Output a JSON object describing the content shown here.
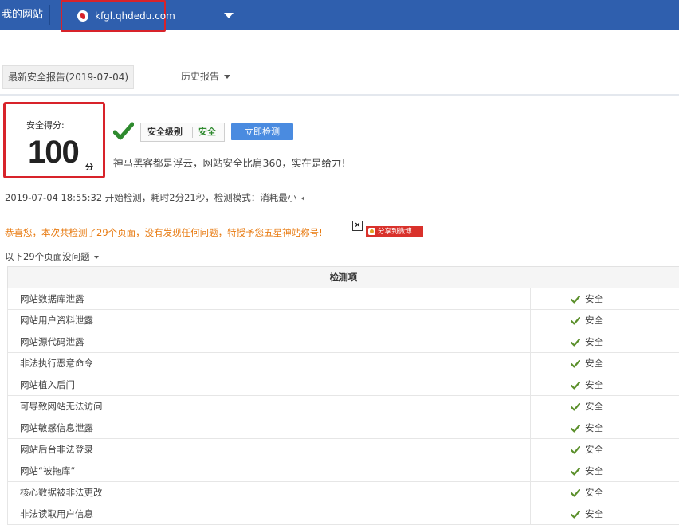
{
  "header": {
    "my_site": "我的网站",
    "domain": "kfgl.qhdedu.com"
  },
  "tabs": {
    "latest": "最新安全报告(2019-07-04)",
    "history": "历史报告"
  },
  "score": {
    "label": "安全得分:",
    "value": "100",
    "unit": "分",
    "level_label": "安全级别",
    "level_value": "安全",
    "detect_button": "立即检测",
    "motto": "神马黑客都是浮云，网站安全比肩360，实在是给力!"
  },
  "scan": {
    "info": "2019-07-04 18:55:32 开始检测，耗时2分21秒，检测模式：消耗最小",
    "congrats": "恭喜您，本次共检测了29个页面，没有发现任何问题，特授予您五星神站称号!",
    "share_button": "分享到微博",
    "close": "×",
    "pages_ok": "以下29个页面没问题"
  },
  "table": {
    "header": "检测项",
    "rows": [
      {
        "item": "网站数据库泄露",
        "status": "安全"
      },
      {
        "item": "网站用户资料泄露",
        "status": "安全"
      },
      {
        "item": "网站源代码泄露",
        "status": "安全"
      },
      {
        "item": "非法执行恶意命令",
        "status": "安全"
      },
      {
        "item": "网站植入后门",
        "status": "安全"
      },
      {
        "item": "可导致网站无法访问",
        "status": "安全"
      },
      {
        "item": "网站敏感信息泄露",
        "status": "安全"
      },
      {
        "item": "网站后台非法登录",
        "status": "安全"
      },
      {
        "item": "网站“被拖库”",
        "status": "安全"
      },
      {
        "item": "核心数据被非法更改",
        "status": "安全"
      },
      {
        "item": "非法读取用户信息",
        "status": "安全"
      }
    ]
  },
  "colors": {
    "topbar": "#2f5fae",
    "highlight": "#d8232a",
    "safe_green": "#2e8a2e",
    "warning_orange": "#e87a10",
    "button_blue": "#4a8be0"
  }
}
